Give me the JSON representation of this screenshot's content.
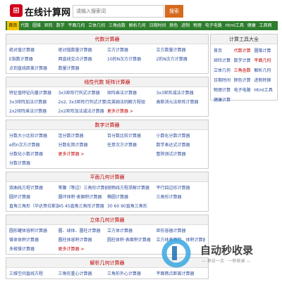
{
  "header": {
    "logo_mark": "⊞",
    "logo_text": "在线计算网",
    "search_placeholder": "请输入搜索词",
    "search_button": "搜索"
  },
  "nav": [
    "首页",
    "代数",
    "圆锥",
    "矩阵",
    "数学",
    "平面几何",
    "立体几何",
    "三角函数",
    "解析几何",
    "日期时间",
    "颜色",
    "进制",
    "物理",
    "电子电路",
    "Html工具",
    "健康",
    "工具网"
  ],
  "sections": [
    {
      "title": "代数计算器",
      "items": [
        "绝对值计算器",
        "绝对值数量计算器",
        "立方计算器",
        "立方数量计算器",
        "E指数计算器",
        "两直线交点计算器",
        "10的N次方计算器",
        "2的N次方计算器",
        "点到直线距离计算器",
        "数量计算器",
        "",
        ""
      ]
    },
    {
      "title": "线性代数 矩阵计算器",
      "items": [
        "特征值特征向量计算器",
        "3x3矩阵行列式计算器",
        "矩阵乘法计算器",
        "3x3矩阵减法计算器",
        "3x3矩阵加法计算器",
        "2x2, 3x3矩阵行列式计算器",
        "克莱姆法则解方程组",
        "高斯消元法矩阵计算器",
        "2x2矩阵乘法计算器",
        "2x2矩阵加法减法计算器",
        "更多计算器 >",
        ""
      ]
    },
    {
      "title": "数字计算器",
      "items": [
        "分数大小比较计算器",
        "连分数计算器",
        "百分数比较计算器",
        "小数化分数计算器",
        "e的n次方计算器",
        "分数化简计算器",
        "任意次方计算器",
        "数学表达式计算器",
        "分数化小数计算器",
        "更多计算器 >",
        "",
        "整除测试计算器",
        "分数计算器"
      ]
    },
    {
      "title": "平面几何计算器",
      "items": [
        "双曲线方程计算器",
        "等腰（等边）三角形计算器",
        "抛物线方程求解计算器",
        "平行四边形计算器",
        "圆环计算器",
        "圆环体积·表面积计算器",
        "椭圆计算器",
        "三角形计算器",
        "直角三角形（毕达哥拉斯定理）",
        "45 45直角三角形计算器",
        "30 60 90直角三角形",
        ""
      ]
    },
    {
      "title": "立体几何计算器",
      "items": [
        "圆形罐体容积计算器",
        "圆、球体、圆柱计算器",
        "立方体计算器",
        "矩形容器计算器",
        "锥体体积计算器",
        "圆柱体容积计算器",
        "圆柱体积·表面积计算器",
        "立方体表面积、体积计算器",
        "多棱锥计算器",
        "更多计算器 >",
        "",
        ""
      ]
    },
    {
      "title": "解析几何计算器",
      "items": [
        "三维空间直线方程",
        "三角形重心计算器",
        "三角形外心计算器",
        "平面两点距离计算器"
      ]
    }
  ],
  "side": {
    "title": "计算工具大全",
    "items": [
      {
        "label": "首页",
        "red": false
      },
      {
        "label": "代数计算",
        "red": true
      },
      {
        "label": "圆锥计算",
        "red": false
      },
      {
        "label": "矩阵计算",
        "red": false
      },
      {
        "label": "数学计算",
        "red": false
      },
      {
        "label": "平面几何",
        "red": true
      },
      {
        "label": "立体几何",
        "red": false
      },
      {
        "label": "三角函数",
        "red": true
      },
      {
        "label": "解析几何",
        "red": false
      },
      {
        "label": "日期时间",
        "red": false
      },
      {
        "label": "颜色计算",
        "red": false
      },
      {
        "label": "进制转换",
        "red": false
      },
      {
        "label": "物理计算",
        "red": false
      },
      {
        "label": "电子电路",
        "red": false
      },
      {
        "label": "Html工具",
        "red": false
      },
      {
        "label": "健康计算",
        "red": false
      },
      {
        "label": "",
        "red": false
      },
      {
        "label": "",
        "red": false
      }
    ]
  },
  "watermark": {
    "text": "自动秒收录",
    "sub": "— 来访一次 · 一秒收录 —"
  }
}
